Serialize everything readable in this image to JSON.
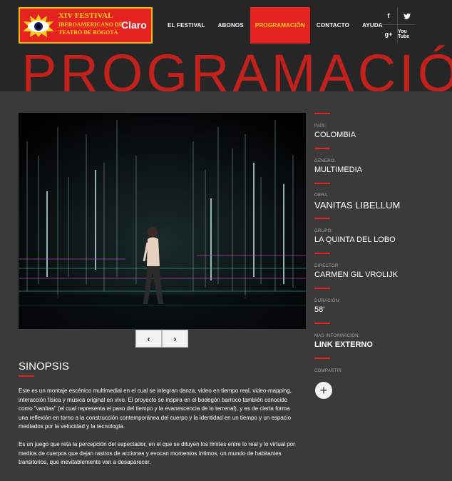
{
  "header": {
    "logo": {
      "line1": "XIV FESTIVAL",
      "line2": "IBEROAMERICANO DE",
      "line3": "TEATRO DE BOGOTÁ",
      "sponsor": "Claro"
    },
    "nav": [
      {
        "label": "EL FESTIVAL"
      },
      {
        "label": "ABONOS"
      },
      {
        "label": "PROGRAMACIÓN"
      },
      {
        "label": "CONTACTO"
      },
      {
        "label": "AYUDA"
      }
    ],
    "social": [
      "f",
      "t",
      "g+",
      "You Tube"
    ]
  },
  "page_title": "PROGRAMACIÓN",
  "slider": {
    "prev": "‹",
    "next": "›"
  },
  "synopsis": {
    "title": "SINOPSIS",
    "paragraphs": [
      "Este es un montaje escénico multimedial en el cual se integran danza, video en tiempo real, video-mapping, interacción física y música original en vivo. El proyecto se inspira en el bodegón barroco también conocido como \"vanitas\" (el cual representa el paso del tiempo y la evanescencia de lo terrenal), y es de cierta forma una reflexión en torno a la construcción contemporánea del cuerpo y la identidad en un tiempo y un espacio mediados por la velocidad y la tecnología.",
      "Es un juego que reta la percepción del espectador, en el que se diluyen los límites entre lo real y lo virtual por medios de cuerpos que dejan rastros de acciones y evocan momentos íntimos, un mundo de habitantes transitorios, que inevitablemente van a desaparecer."
    ]
  },
  "info": [
    {
      "label": "PAÍS:",
      "value": "COLOMBIA"
    },
    {
      "label": "GÉNERO:",
      "value": "MULTIMEDIA"
    },
    {
      "label": "OBRA:",
      "value": "VANITAS LIBELLUM"
    },
    {
      "label": "GRUPO:",
      "value": "LA QUINTA DEL LOBO"
    },
    {
      "label": "DIRECTOR:",
      "value": "CARMEN GIL VROLIJK"
    },
    {
      "label": "DURACIÓN:",
      "value": "58'"
    },
    {
      "label": "MAS INFORMACIÓN:",
      "value": "LINK EXTERNO"
    },
    {
      "label": "COMPARTIR",
      "value": ""
    }
  ],
  "colors": {
    "accent": "#e52421",
    "header_bg": "#262626",
    "page_bg": "#3a3a3a",
    "highlight": "#ffd21a"
  }
}
